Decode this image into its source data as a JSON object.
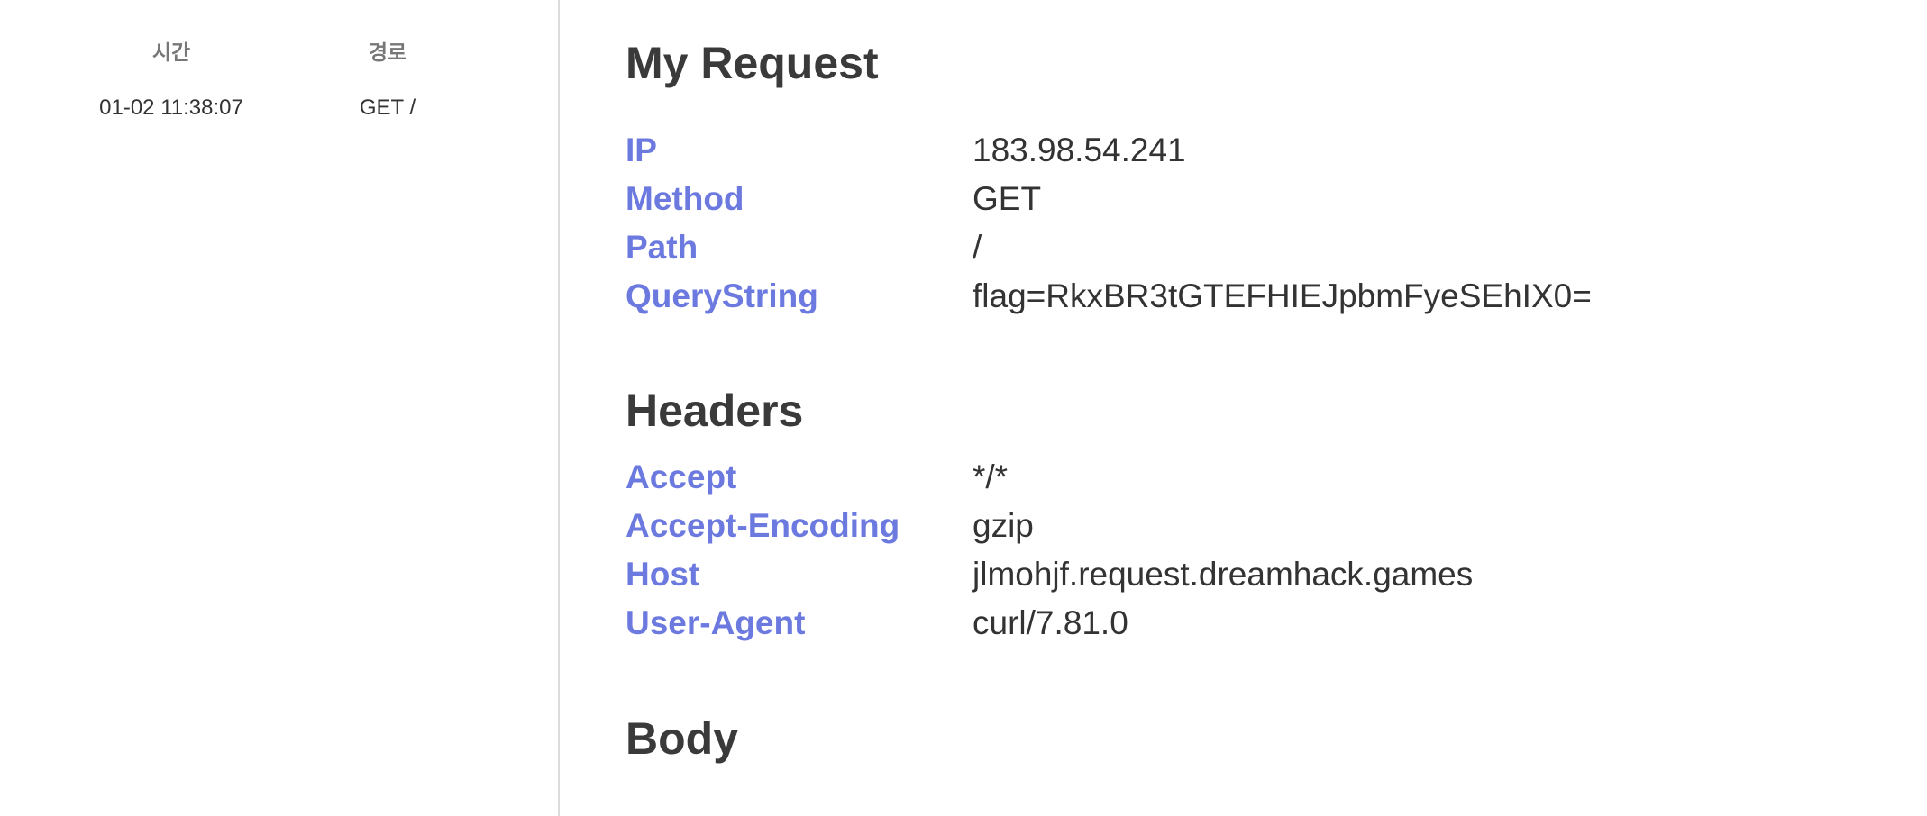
{
  "sidebar": {
    "columns": {
      "time": "시간",
      "path": "경로"
    },
    "rows": [
      {
        "time": "01-02 11:38:07",
        "path": "GET /"
      }
    ]
  },
  "request": {
    "title": "My Request",
    "fields": [
      {
        "key": "IP",
        "value": "183.98.54.241"
      },
      {
        "key": "Method",
        "value": "GET"
      },
      {
        "key": "Path",
        "value": "/"
      },
      {
        "key": "QueryString",
        "value": "flag=RkxBR3tGTEFHIEJpbmFyeSEhIX0="
      }
    ]
  },
  "headers": {
    "title": "Headers",
    "fields": [
      {
        "key": "Accept",
        "value": "*/*"
      },
      {
        "key": "Accept-Encoding",
        "value": "gzip"
      },
      {
        "key": "Host",
        "value": "jlmohjf.request.dreamhack.games"
      },
      {
        "key": "User-Agent",
        "value": "curl/7.81.0"
      }
    ]
  },
  "body": {
    "title": "Body"
  },
  "colors": {
    "key": "#6c7ae0",
    "value": "#333333",
    "heading": "#3a3a3a",
    "divider": "#dcdcdc"
  }
}
